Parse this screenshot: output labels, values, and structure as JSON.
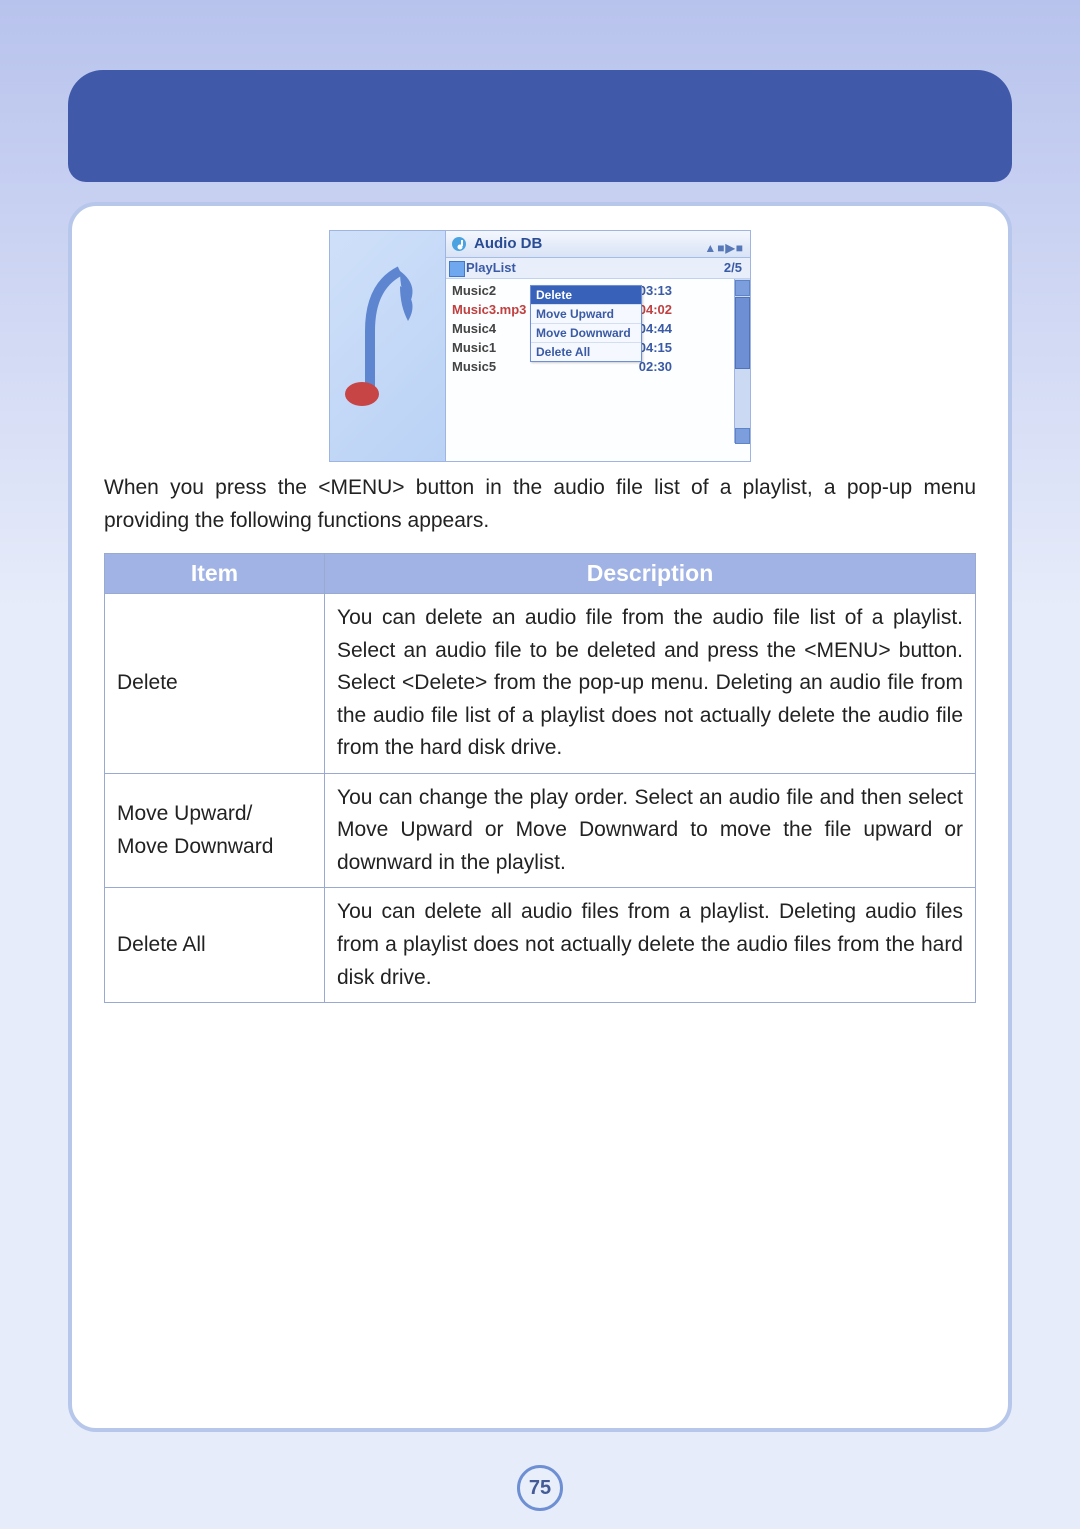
{
  "page_number": "75",
  "screenshot": {
    "title": "Audio DB",
    "playlist_label": "PlayList",
    "page_counter": "2/5",
    "tracks": [
      {
        "name": "Music2",
        "time": "03:13",
        "selected": false
      },
      {
        "name": "Music3.mp3",
        "time": "04:02",
        "selected": true
      },
      {
        "name": "Music4",
        "time": "04:44",
        "selected": false
      },
      {
        "name": "Music1",
        "time": "04:15",
        "selected": false
      },
      {
        "name": "Music5",
        "time": "02:30",
        "selected": false
      }
    ],
    "popup_menu": [
      {
        "label": "Delete",
        "selected": true
      },
      {
        "label": "Move Upward",
        "selected": false
      },
      {
        "label": "Move Downward",
        "selected": false
      },
      {
        "label": "Delete All",
        "selected": false
      }
    ]
  },
  "body_text": "When you press the <MENU> button in the audio file list of a playlist, a pop-up menu providing the following functions appears.",
  "table": {
    "headers": {
      "item": "Item",
      "description": "Description"
    },
    "rows": [
      {
        "item": "Delete",
        "desc": "You can delete an audio file from the audio file list of a playlist. Select an audio file to be deleted and press the <MENU> button. Select <Delete> from the pop-up menu. Deleting an audio file from the audio file list of a playlist does not actually delete the audio file from the hard disk drive."
      },
      {
        "item": "Move Upward/\nMove Downward",
        "desc": "You can change the play order. Select an audio file and then select Move Upward or Move Downward to move the file upward or downward in the playlist."
      },
      {
        "item": "Delete All",
        "desc": "You can delete all audio files from a playlist. Deleting audio files from a playlist does not actually delete the audio files from the hard disk drive."
      }
    ]
  }
}
